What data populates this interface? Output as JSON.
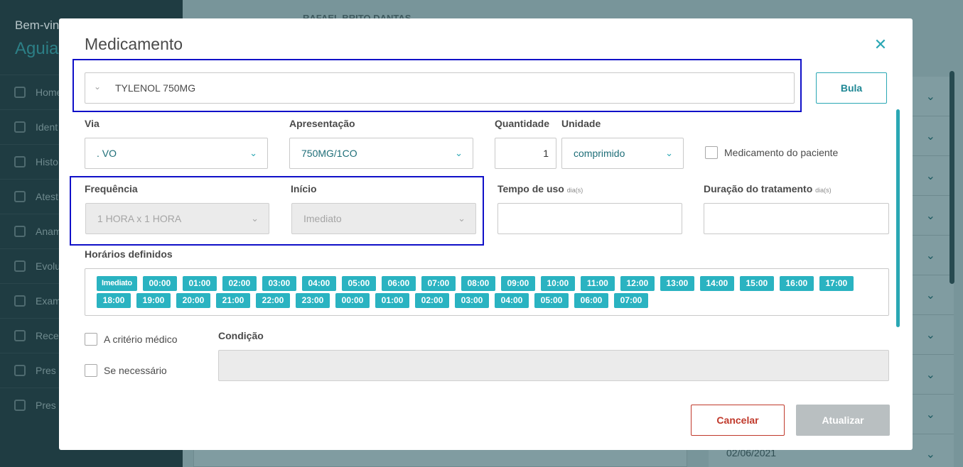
{
  "background": {
    "welcome": "Bem-vin",
    "user_name": "Aguia",
    "menu": [
      "Home",
      "Ident",
      "Histo",
      "Atest",
      "Anam",
      "Evolu",
      "Exam",
      "Rece",
      "Pres",
      "Pres Enfe"
    ],
    "patient": "RAFAEL BRITO DANTAS",
    "date": "02/06/2021"
  },
  "modal": {
    "title": "Medicamento",
    "close_icon": "close-icon",
    "medication": {
      "value": "TYLENOL 750MG"
    },
    "bula_label": "Bula",
    "via": {
      "label": "Via",
      "value": ". VO"
    },
    "apresentacao": {
      "label": "Apresentação",
      "value": "750MG/1CO"
    },
    "quantidade": {
      "label": "Quantidade",
      "value": "1"
    },
    "unidade": {
      "label": "Unidade",
      "value": "comprimido"
    },
    "medicamento_paciente": {
      "label": "Medicamento do paciente",
      "checked": false
    },
    "frequencia": {
      "label": "Frequência",
      "value": "1 HORA x 1 HORA"
    },
    "inicio": {
      "label": "Início",
      "value": "Imediato"
    },
    "tempo_uso": {
      "label": "Tempo de uso",
      "unit": "dia(s)",
      "value": ""
    },
    "duracao": {
      "label": "Duração do tratamento",
      "unit": "dia(s)",
      "value": ""
    },
    "horarios": {
      "label": "Horários definidos",
      "times": [
        "Imediato",
        "00:00",
        "01:00",
        "02:00",
        "03:00",
        "04:00",
        "05:00",
        "06:00",
        "07:00",
        "08:00",
        "09:00",
        "10:00",
        "11:00",
        "12:00",
        "13:00",
        "14:00",
        "15:00",
        "16:00",
        "17:00",
        "18:00",
        "19:00",
        "20:00",
        "21:00",
        "22:00",
        "23:00",
        "00:00",
        "01:00",
        "02:00",
        "03:00",
        "04:00",
        "05:00",
        "06:00",
        "07:00"
      ]
    },
    "criterio_medico": {
      "label": "A critério médico",
      "checked": false
    },
    "se_necessario": {
      "label": "Se necessário",
      "checked": false
    },
    "condicao": {
      "label": "Condição",
      "value": ""
    },
    "cancel_label": "Cancelar",
    "update_label": "Atualizar"
  },
  "colors": {
    "accent": "#2aa7b4",
    "chip": "#2ab3c1",
    "highlight": "#1010c8",
    "cancel": "#c0392b",
    "disabled_button": "#b9bfc1"
  }
}
